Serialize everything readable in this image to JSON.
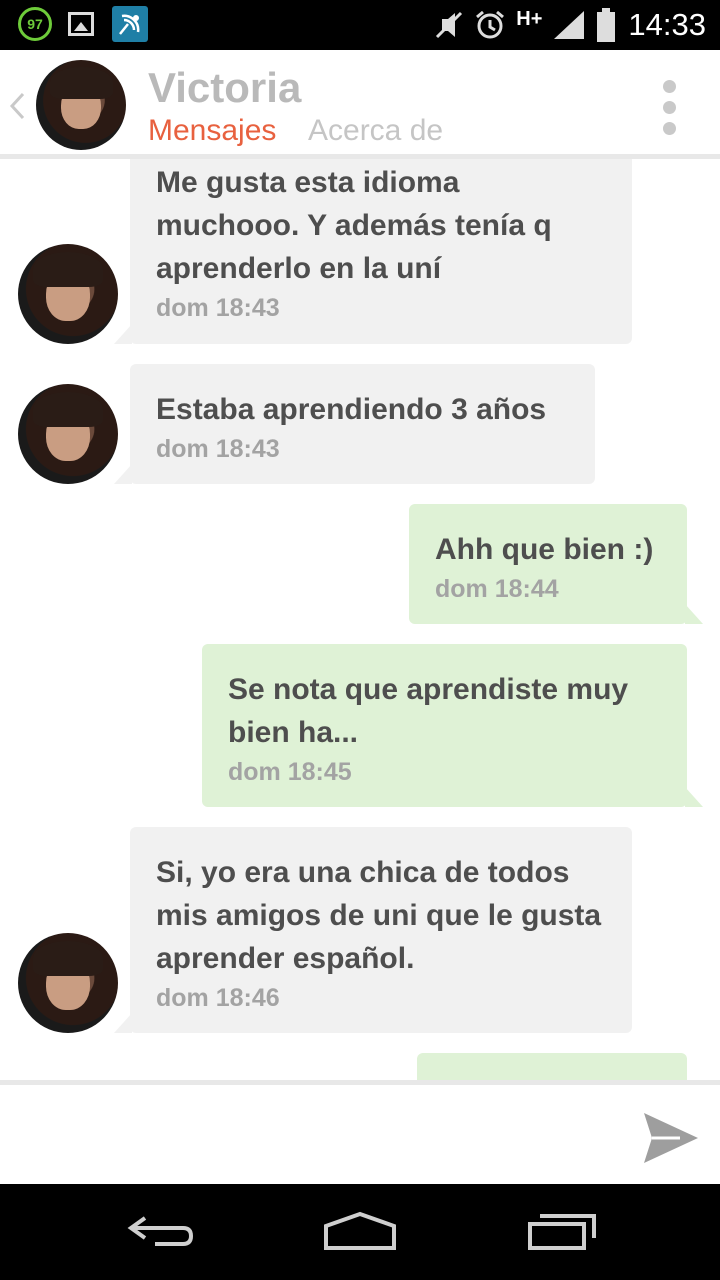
{
  "status_bar": {
    "battery_badge": "97",
    "network": "H+",
    "time": "14:33"
  },
  "header": {
    "contact_name": "Victoria",
    "tabs": [
      {
        "label": "Mensajes",
        "active": true
      },
      {
        "label": "Acerca de",
        "active": false
      }
    ]
  },
  "messages": [
    {
      "direction": "in",
      "text": "Me gusta esta idioma muchooo. Y además tenía q aprenderlo en la uní",
      "time": "dom 18:43"
    },
    {
      "direction": "in",
      "text": "Estaba aprendiendo 3 años",
      "time": "dom 18:43"
    },
    {
      "direction": "out",
      "text": "Ahh que bien :)",
      "time": "dom 18:44"
    },
    {
      "direction": "out",
      "text": "Se nota que aprendiste muy bien ha...",
      "time": "dom 18:45"
    },
    {
      "direction": "in",
      "text": "Si, yo era una chica de todos mis amigos de uni que le gusta aprender español.",
      "time": "dom 18:46"
    },
    {
      "direction": "out",
      "text": "",
      "time": ""
    }
  ],
  "input": {
    "value": "",
    "placeholder": ""
  },
  "colors": {
    "accent": "#e8613f",
    "incoming_bubble": "#f1f1f1",
    "outgoing_bubble": "#dff2d6",
    "name": "#b9b9b9"
  },
  "icons": {
    "back": "chevron-left-icon",
    "menu": "overflow-menu-icon",
    "send": "send-icon",
    "nav_back": "nav-back-icon",
    "nav_home": "nav-home-icon",
    "nav_recents": "nav-recents-icon"
  }
}
